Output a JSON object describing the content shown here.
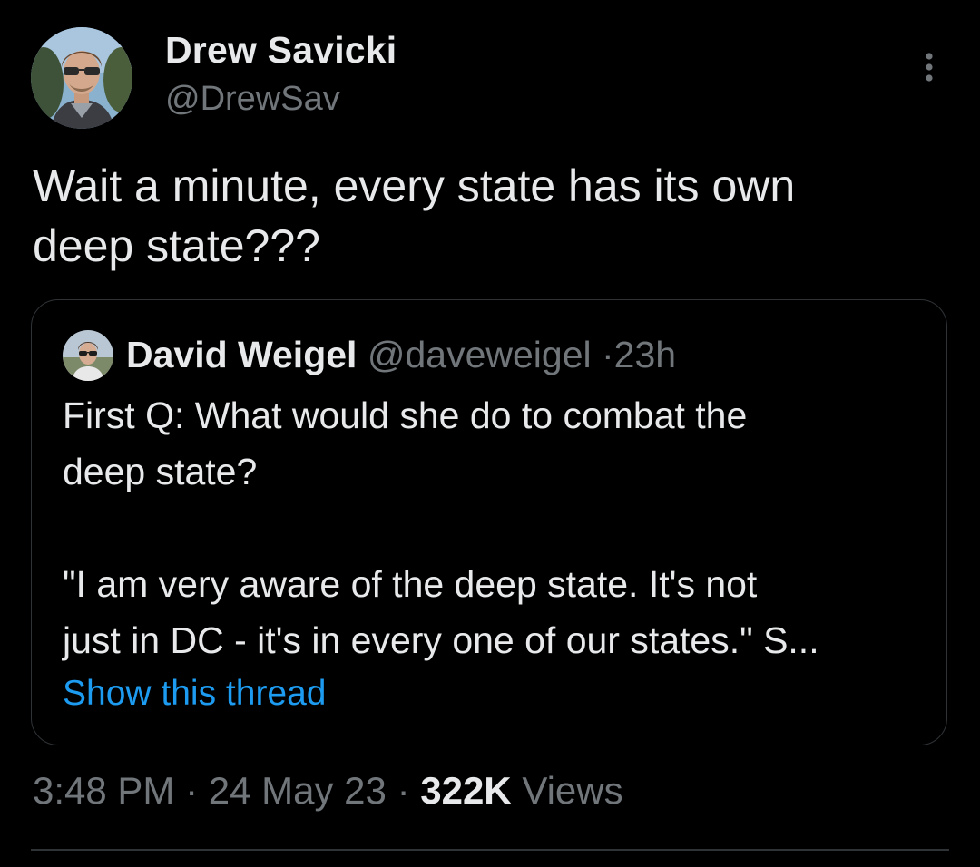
{
  "author": {
    "name": "Drew Savicki",
    "handle": "@DrewSav"
  },
  "tweet": {
    "line1": "Wait a minute, every state has its own",
    "line2": "deep state???"
  },
  "quote": {
    "name": "David Weigel",
    "handle": "@daveweigel",
    "separator": "·",
    "age": "23h",
    "line1": "First Q: What would she do to combat the",
    "line2": "deep state?",
    "line3": "\"I am very aware of the deep state. It's not",
    "line4": "just in DC - it's in every one of our states.\" S...",
    "show_thread": "Show this thread"
  },
  "footer": {
    "time": "3:48 PM",
    "sep1": "·",
    "date": "24 May 23",
    "sep2": "·",
    "views_count": "322K",
    "views_label": "Views"
  },
  "icons": {
    "more": "more-vertical-icon"
  },
  "colors": {
    "background": "#000000",
    "text": "#e7e9ea",
    "secondary": "#71767b",
    "link": "#1d9bf0",
    "border": "#2f3336"
  }
}
